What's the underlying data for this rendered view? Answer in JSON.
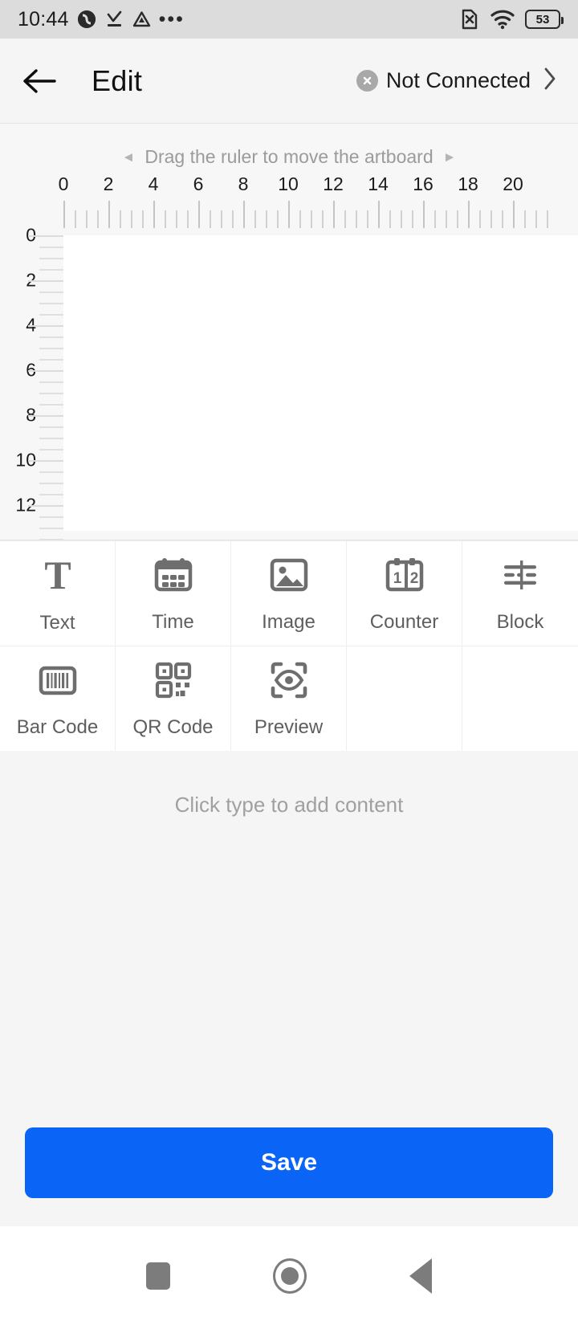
{
  "status_bar": {
    "time": "10:44",
    "left_icons": [
      "sync-app-icon",
      "download-check-icon",
      "triangle-app-icon",
      "more-dots-icon"
    ],
    "right_icons": [
      "sim-card-off-icon",
      "wifi-icon"
    ],
    "battery_percent": "53"
  },
  "header": {
    "back_icon": "back-arrow-icon",
    "title": "Edit",
    "connection_status": "Not Connected",
    "connection_icon": "close-circle-icon",
    "chevron_icon": "chevron-right-icon"
  },
  "editor": {
    "hint": "Drag the ruler to move the artboard",
    "hint_left_icon": "triangle-left-icon",
    "hint_right_icon": "triangle-right-icon",
    "h_ruler_labels": [
      "0",
      "2",
      "4",
      "6",
      "8",
      "10",
      "12",
      "14",
      "16",
      "18",
      "20"
    ],
    "v_ruler_labels": [
      "0",
      "2",
      "4",
      "6",
      "8",
      "10",
      "12"
    ],
    "artboard_color": "#ffffff"
  },
  "tools": [
    {
      "label": "Text",
      "icon": "text-icon"
    },
    {
      "label": "Time",
      "icon": "calendar-icon"
    },
    {
      "label": "Image",
      "icon": "image-icon"
    },
    {
      "label": "Counter",
      "icon": "counter-icon"
    },
    {
      "label": "Block",
      "icon": "block-align-icon"
    },
    {
      "label": "Bar Code",
      "icon": "barcode-icon"
    },
    {
      "label": "QR Code",
      "icon": "qrcode-icon"
    },
    {
      "label": "Preview",
      "icon": "preview-eye-icon"
    },
    {
      "label": "",
      "icon": ""
    },
    {
      "label": "",
      "icon": ""
    }
  ],
  "content": {
    "placeholder": "Click type to add content"
  },
  "footer": {
    "save_label": "Save",
    "save_color": "#0a64f5"
  },
  "nav_bar": {
    "recents_icon": "square-recents-icon",
    "home_icon": "circle-home-icon",
    "back_icon": "triangle-back-icon"
  }
}
